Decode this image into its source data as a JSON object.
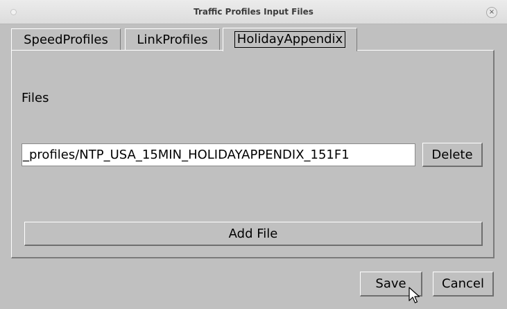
{
  "window": {
    "title": "Traffic Profiles Input Files",
    "close_glyph": "×"
  },
  "tabs": [
    {
      "label": "SpeedProfiles",
      "active": false
    },
    {
      "label": "LinkProfiles",
      "active": false
    },
    {
      "label": "HolidayAppendix",
      "active": true
    }
  ],
  "panel": {
    "files_label": "Files",
    "file_path": "_profiles/NTP_USA_15MIN_HOLIDAYAPPENDIX_151F1",
    "delete_label": "Delete",
    "add_file_label": "Add File"
  },
  "footer": {
    "save_label": "Save",
    "cancel_label": "Cancel"
  }
}
